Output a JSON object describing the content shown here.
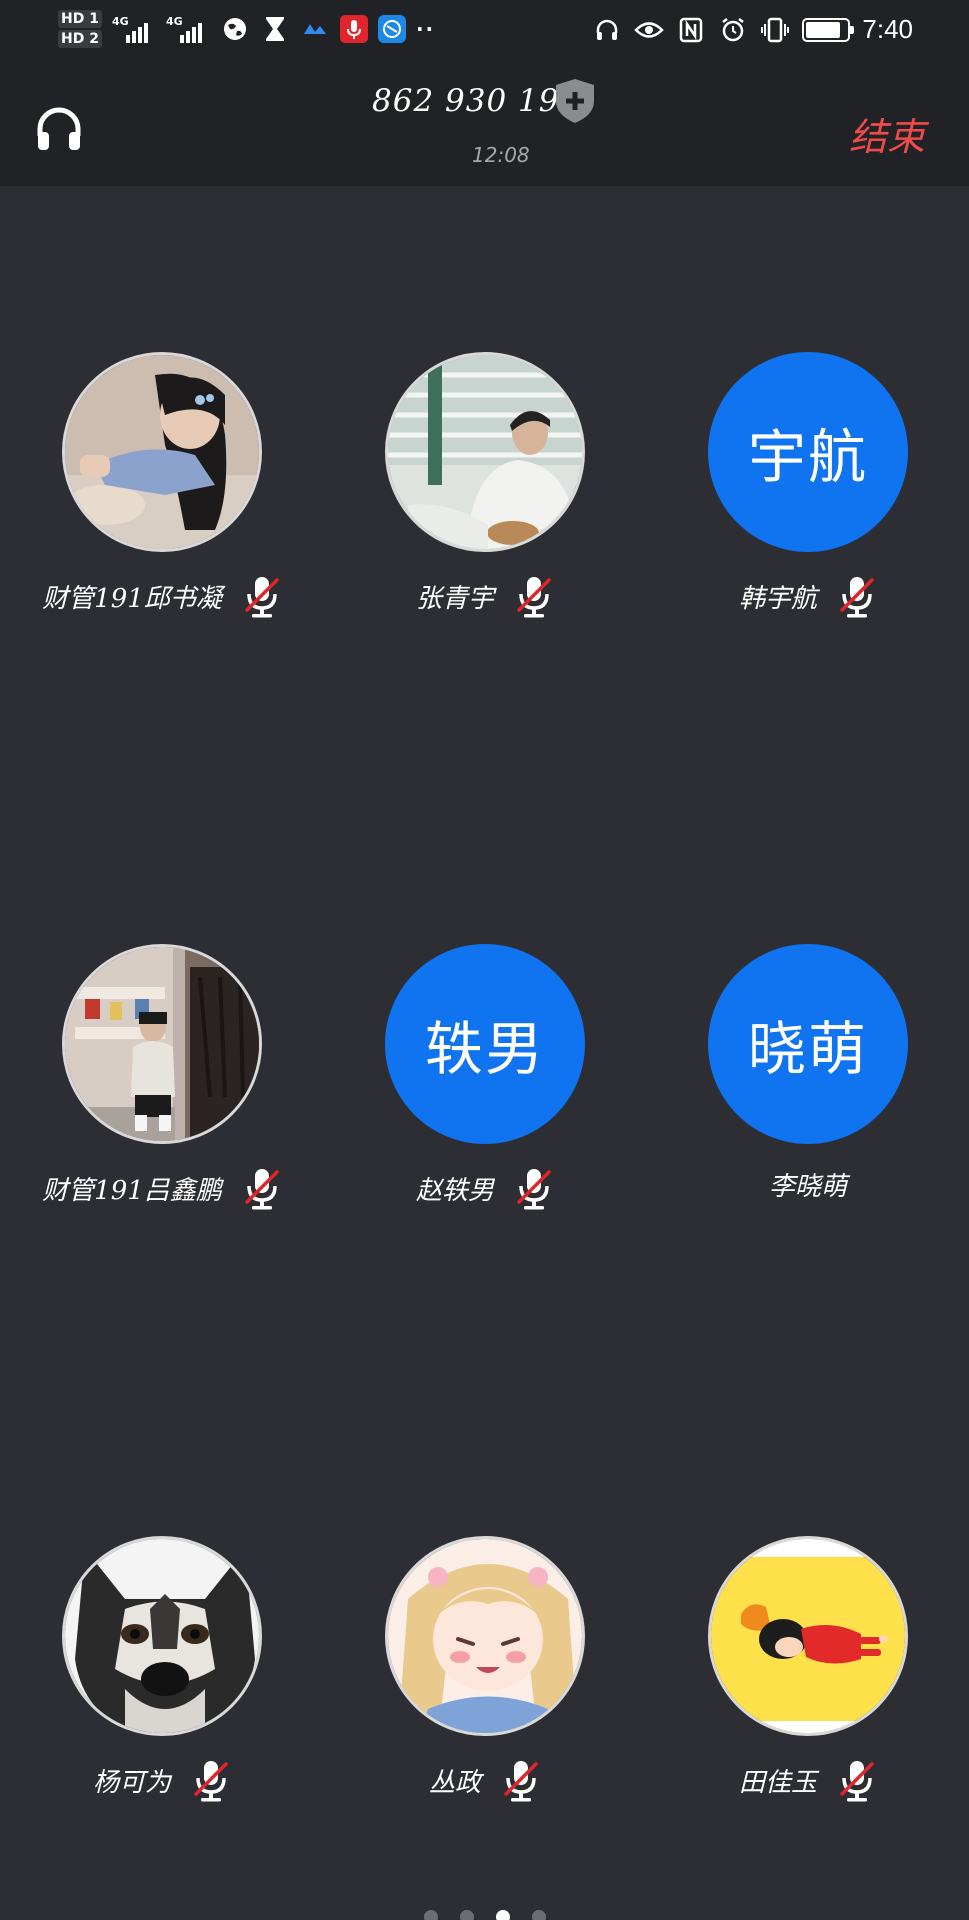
{
  "status_bar": {
    "sim1": "HD 1",
    "sim2": "HD 2",
    "net1": "4G",
    "net2": "4G",
    "time": "7:40",
    "battery_level": 0.85
  },
  "header": {
    "meeting_id": "862 930 190",
    "duration": "12:08",
    "end_label": "结束"
  },
  "participants": [
    {
      "name": "财管191邱书凝",
      "avatar_type": "photo",
      "muted": true
    },
    {
      "name": "张青宇",
      "avatar_type": "photo",
      "muted": true
    },
    {
      "name": "韩宇航",
      "avatar_type": "text",
      "avatar_text": "宇航",
      "muted": true
    },
    {
      "name": "财管191吕鑫鹏",
      "avatar_type": "photo",
      "muted": true
    },
    {
      "name": "赵轶男",
      "avatar_type": "text",
      "avatar_text": "轶男",
      "muted": true
    },
    {
      "name": "李晓萌",
      "avatar_type": "text",
      "avatar_text": "晓萌",
      "muted": false
    },
    {
      "name": "杨可为",
      "avatar_type": "photo",
      "muted": true
    },
    {
      "name": "丛政",
      "avatar_type": "photo",
      "muted": true
    },
    {
      "name": "田佳玉",
      "avatar_type": "photo",
      "muted": true
    }
  ],
  "colors": {
    "background": "#2c2e33",
    "header": "#212226",
    "avatar_blue": "#1073f0",
    "end_red": "#ee4b4b",
    "mute_red": "#e0262c"
  },
  "icons": [
    "headset-icon",
    "shield-add-icon",
    "mic-muted-icon"
  ],
  "pagination": {
    "pages": 4,
    "current": 3
  }
}
